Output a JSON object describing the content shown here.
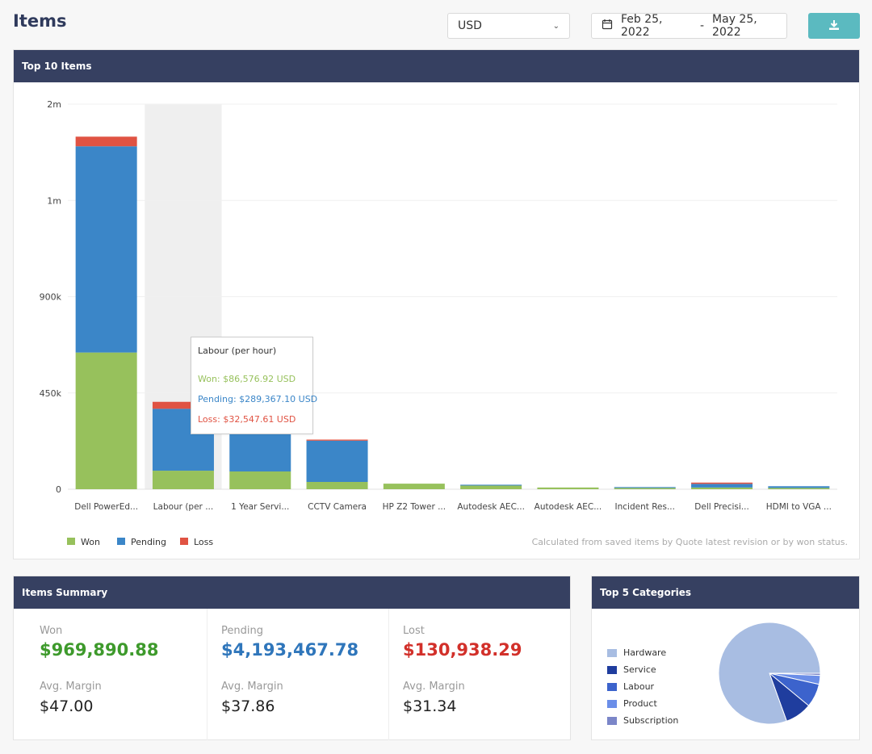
{
  "header": {
    "title": "Items",
    "currency": "USD",
    "date_start": "Feb 25, 2022",
    "date_sep": "-",
    "date_end": "May 25, 2022",
    "calendar_icon": "calendar-icon",
    "download_icon": "download-icon"
  },
  "top10": {
    "title": "Top 10 Items",
    "footnote": "Calculated from saved items by Quote latest revision or by won status.",
    "tooltip": {
      "title": "Labour (per hour)",
      "won": "Won: $86,576.92 USD",
      "pending": "Pending: $289,367.10 USD",
      "loss": "Loss: $32,547.61 USD"
    }
  },
  "colors": {
    "won": "#97c15c",
    "pending": "#3b86c8",
    "loss": "#e05343",
    "header_bg": "#364061",
    "accent": "#5bbac0"
  },
  "chart_data": [
    {
      "type": "bar",
      "stacked": true,
      "title": "Top 10 Items",
      "xlabel": "",
      "ylabel": "",
      "categories": [
        "Dell PowerEd...",
        "Labour (per ...",
        "1 Year Servi...",
        "CCTV Camera",
        "HP Z2 Tower ...",
        "Autodesk AEC...",
        "Autodesk AEC...",
        "Incident Res...",
        "Dell Precisi...",
        "HDMI to VGA ..."
      ],
      "series": [
        {
          "name": "Won",
          "values": [
            639000,
            86576.92,
            83000,
            34000,
            26000,
            17000,
            8000,
            6000,
            8000,
            6000
          ]
        },
        {
          "name": "Pending",
          "values": [
            964000,
            289367.1,
            174000,
            193000,
            0,
            4000,
            0,
            4000,
            17000,
            8000
          ]
        },
        {
          "name": "Loss",
          "values": [
            45000,
            32547.61,
            0,
            5000,
            0,
            0,
            0,
            0,
            6000,
            0
          ]
        }
      ],
      "yticks": [
        0,
        450000,
        900000,
        1350000,
        1800000
      ],
      "ytick_labels": [
        "0",
        "450k",
        "900k",
        "1m",
        "2m"
      ],
      "ylim": [
        0,
        1800000
      ],
      "grid": true,
      "highlighted_category": "Labour (per ...",
      "legend": [
        "Won",
        "Pending",
        "Loss"
      ],
      "legend_position": "bottom-left"
    },
    {
      "type": "pie",
      "title": "Top 5 Categories",
      "labels": [
        "Hardware",
        "Service",
        "Labour",
        "Product",
        "Subscription"
      ],
      "values": [
        80.5,
        8.5,
        7.5,
        2.8,
        0.7
      ],
      "colors": [
        "#a8bde2",
        "#1f3d9e",
        "#3c63cc",
        "#6b8ee8",
        "#7b86c8"
      ],
      "legend_position": "left"
    }
  ],
  "summary": {
    "title": "Items Summary",
    "columns": [
      {
        "label": "Won",
        "value": "$969,890.88",
        "color": "#3e9a2c",
        "margin_label": "Avg. Margin",
        "margin_value": "$47.00"
      },
      {
        "label": "Pending",
        "value": "$4,193,467.78",
        "color": "#2f76bb",
        "margin_label": "Avg. Margin",
        "margin_value": "$37.86"
      },
      {
        "label": "Lost",
        "value": "$130,938.29",
        "color": "#d2302a",
        "margin_label": "Avg. Margin",
        "margin_value": "$31.34"
      }
    ]
  },
  "categories": {
    "title": "Top 5 Categories"
  }
}
